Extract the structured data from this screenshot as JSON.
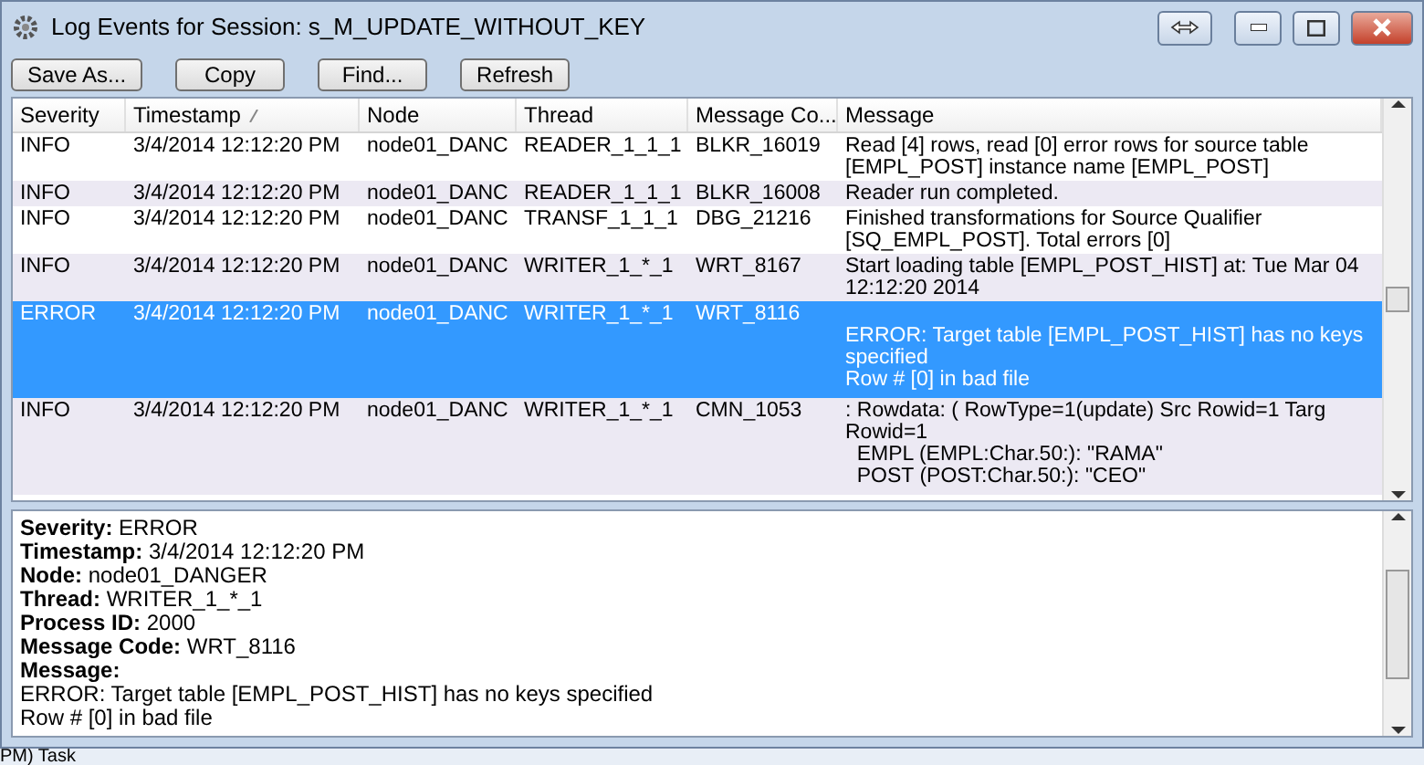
{
  "window": {
    "title": "Log Events for Session: s_M_UPDATE_WITHOUT_KEY"
  },
  "toolbar": {
    "buttons": [
      "Save As...",
      "Copy",
      "Find...",
      "Refresh"
    ]
  },
  "table": {
    "columns": [
      "Severity",
      "Timestamp",
      "Node",
      "Thread",
      "Message Co...",
      "Message"
    ],
    "rows": [
      {
        "severity": "INFO",
        "timestamp": "3/4/2014 12:12:20 PM",
        "node": "node01_DANC",
        "thread": "READER_1_1_1",
        "code": "BLKR_16019",
        "message": [
          "Read [4] rows, read [0] error rows for source table",
          "[EMPL_POST] instance name [EMPL_POST]"
        ],
        "selected": false
      },
      {
        "severity": "INFO",
        "timestamp": "3/4/2014 12:12:20 PM",
        "node": "node01_DANC",
        "thread": "READER_1_1_1",
        "code": "BLKR_16008",
        "message": [
          "Reader run completed."
        ],
        "selected": false
      },
      {
        "severity": "INFO",
        "timestamp": "3/4/2014 12:12:20 PM",
        "node": "node01_DANC",
        "thread": "TRANSF_1_1_1",
        "code": "DBG_21216",
        "message": [
          "Finished transformations for Source Qualifier",
          "[SQ_EMPL_POST]. Total errors [0]"
        ],
        "selected": false
      },
      {
        "severity": "INFO",
        "timestamp": "3/4/2014 12:12:20 PM",
        "node": "node01_DANC",
        "thread": "WRITER_1_*_1",
        "code": "WRT_8167",
        "message": [
          "Start loading table [EMPL_POST_HIST] at: Tue Mar 04",
          "12:12:20 2014"
        ],
        "selected": false
      },
      {
        "severity": "ERROR",
        "timestamp": "3/4/2014 12:12:20 PM",
        "node": "node01_DANC",
        "thread": "WRITER_1_*_1",
        "code": "WRT_8116",
        "blank_first_line": true,
        "message": [
          "ERROR: Target table [EMPL_POST_HIST] has no keys",
          "specified",
          "Row # [0] in bad file"
        ],
        "selected": true
      },
      {
        "severity": "INFO",
        "timestamp": "3/4/2014 12:12:20 PM",
        "node": "node01_DANC",
        "thread": "WRITER_1_*_1",
        "code": "CMN_1053",
        "message": [
          ": Rowdata: ( RowType=1(update) Src Rowid=1 Targ",
          "Rowid=1",
          "  EMPL (EMPL:Char.50:): \"RAMA\"",
          "  POST (POST:Char.50:): \"CEO\""
        ],
        "selected": false
      }
    ]
  },
  "details": {
    "fields": [
      {
        "label": "Severity:",
        "value": "ERROR"
      },
      {
        "label": "Timestamp:",
        "value": "3/4/2014 12:12:20 PM"
      },
      {
        "label": "Node:",
        "value": "node01_DANGER"
      },
      {
        "label": "Thread:",
        "value": "WRITER_1_*_1"
      },
      {
        "label": "Process ID:",
        "value": "2000"
      },
      {
        "label": "Message Code:",
        "value": "WRT_8116"
      },
      {
        "label": "Message:"
      }
    ],
    "message": [
      "ERROR: Target table [EMPL_POST_HIST] has no keys specified",
      "Row # [0] in bad file"
    ]
  },
  "taskbar": {
    "text": "PM) Task"
  }
}
